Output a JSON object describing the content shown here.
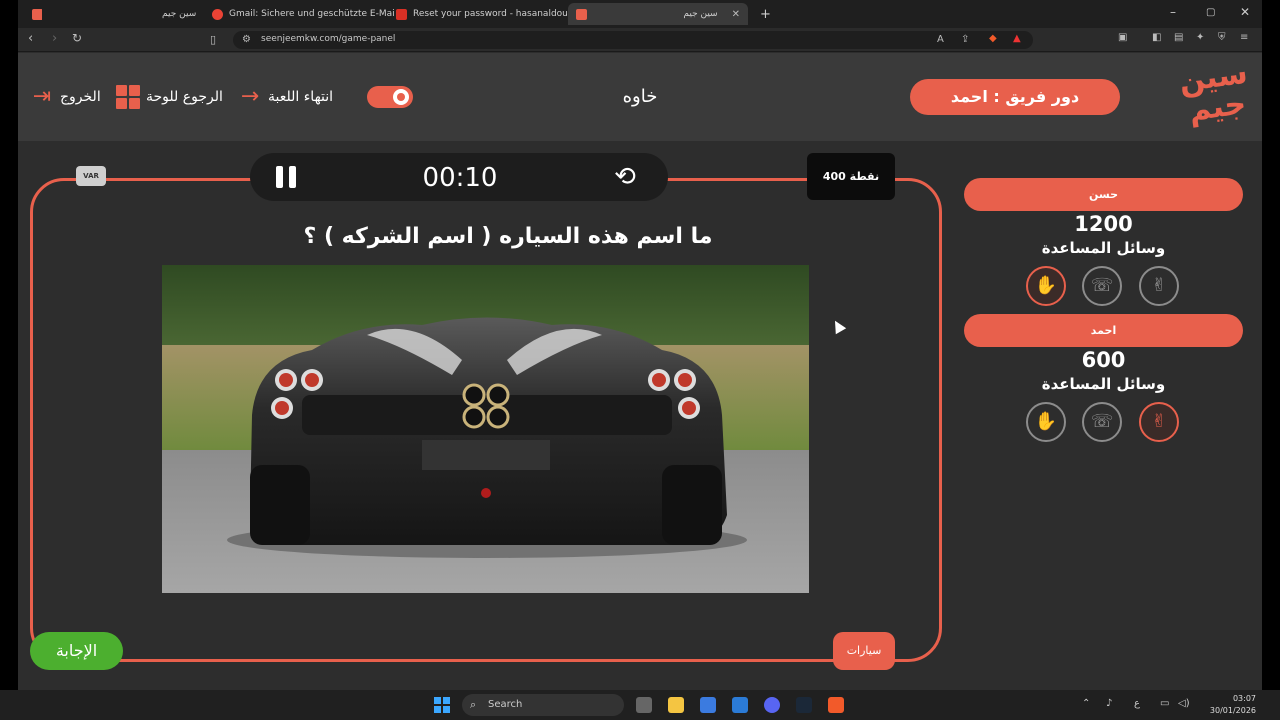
{
  "browser": {
    "tabs": [
      {
        "title": "سين جيم",
        "active": false,
        "favicon_color": "#e8604c"
      },
      {
        "title": "Gmail: Sichere und geschützte E-Mail",
        "active": false,
        "favicon_color": "#ea4335"
      },
      {
        "title": "Reset your password - hasanaldoum",
        "active": false,
        "favicon_color": "#d93025"
      },
      {
        "title": "سين جيم",
        "active": true,
        "favicon_color": "#e8604c"
      }
    ],
    "new_tab": "+",
    "url": "seenjeemkw.com/game-panel",
    "window_controls": [
      "–",
      "▢",
      "✕"
    ]
  },
  "header": {
    "exit_label": "الخروج",
    "board_label": "الرجوع للوحة",
    "end_game_label": "انتهاء اللعبة",
    "category_title": "خاوه",
    "turn_label": "دور فريق : احمد",
    "logo_text": [
      "سين",
      "جيم"
    ],
    "accent_color": "#e8604c"
  },
  "game": {
    "timer": "00:10",
    "points": "400 نقطة",
    "var_label": "VAR",
    "question": "ما اسم هذه السياره ( اسم الشركه ) ؟",
    "answer_button": "الإجابة",
    "category_tag": "سيارات"
  },
  "teams": [
    {
      "name": "حسن",
      "score": "1200",
      "aids_label": "وسائل المساعدة",
      "aids": [
        {
          "icon": "hand-icon",
          "active": true
        },
        {
          "icon": "call-icon",
          "active": false
        },
        {
          "icon": "peace-hand-icon",
          "active": false
        }
      ]
    },
    {
      "name": "احمد",
      "score": "600",
      "aids_label": "وسائل المساعدة",
      "aids": [
        {
          "icon": "hand-icon",
          "active": false
        },
        {
          "icon": "call-icon",
          "active": false
        },
        {
          "icon": "peace-hand-icon",
          "active": true
        }
      ]
    }
  ],
  "taskbar": {
    "search_placeholder": "Search",
    "time": "03:07",
    "date": "30/01/2026",
    "lang": "ع"
  }
}
